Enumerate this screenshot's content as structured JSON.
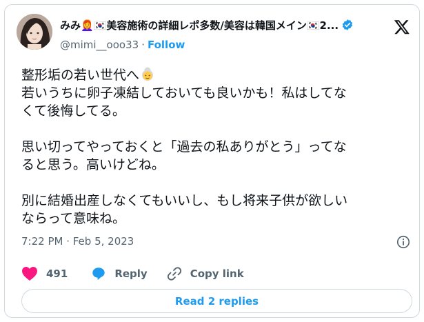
{
  "author": {
    "display_name": "みみ👩‍🦰🇰🇷美容施術の詳細レポ多数/美容は韓国メイン🇰🇷2...",
    "handle": "@mimi__ooo33",
    "separator": "·",
    "follow_label": "Follow",
    "verified_badge": "verified-badge-icon"
  },
  "tweet": {
    "line_1": "整形垢の若い世代へ",
    "line_1_emoji": "older-woman-emoji",
    "line_2": "若いうちに卵子凍結しておいても良いかも！私はしてな",
    "line_3": "くて後悔してる。",
    "line_4": "思い切ってやっておくと「過去の私ありがとう」ってな",
    "line_5": "ると思う。高いけどね。",
    "line_6": "別に結婚出産しなくてもいいし、もし将来子供が欲しい",
    "line_7": "ならって意味ね。"
  },
  "timestamp": "7:22 PM · Feb 5, 2023",
  "actions": {
    "like_count": "491",
    "reply_label": "Reply",
    "copy_label": "Copy link"
  },
  "read_replies_label": "Read 2 replies",
  "colors": {
    "accent": "#1d9bf0",
    "like": "#f91880",
    "muted": "#536471",
    "text": "#0f1419",
    "border": "#cfd9de"
  }
}
